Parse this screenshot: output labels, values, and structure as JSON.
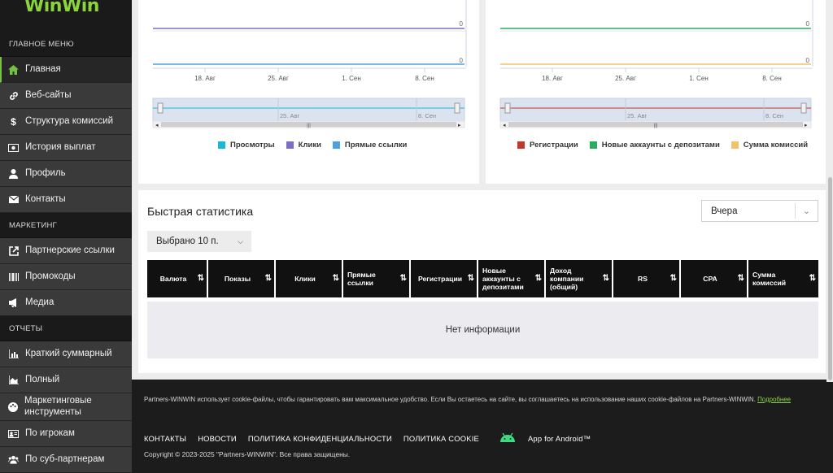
{
  "brand": {
    "logo_text": "WinWin",
    "accent": "#76c043"
  },
  "sidebar": {
    "sections": [
      {
        "title": "ГЛАВНОЕ МЕНЮ",
        "items": [
          {
            "label": "Главная",
            "icon": "home-icon",
            "active": true
          },
          {
            "label": "Веб-сайты",
            "icon": "link-icon"
          },
          {
            "label": "Структура комиссий",
            "icon": "dollar-icon"
          },
          {
            "label": "История выплат",
            "icon": "money-icon"
          },
          {
            "label": "Профиль",
            "icon": "user-icon"
          },
          {
            "label": "Контакты",
            "icon": "envelope-icon"
          }
        ]
      },
      {
        "title": "МАРКЕТИНГ",
        "items": [
          {
            "label": "Партнерские ссылки",
            "icon": "external-link-icon"
          },
          {
            "label": "Промокоды",
            "icon": "barcode-icon"
          },
          {
            "label": "Медиа",
            "icon": "megaphone-icon"
          }
        ]
      },
      {
        "title": "ОТЧЕТЫ",
        "items": [
          {
            "label": "Краткий суммарный",
            "icon": "bar-chart-icon"
          },
          {
            "label": "Полный",
            "icon": "area-chart-icon"
          },
          {
            "label": "Маркетинговые инструменты",
            "icon": "palette-icon"
          },
          {
            "label": "По игрокам",
            "icon": "id-card-icon"
          },
          {
            "label": "По суб-партнерам",
            "icon": "users-icon"
          }
        ]
      }
    ]
  },
  "chart_data": [
    {
      "type": "line",
      "x_ticks": [
        "18. Авг",
        "25. Авг",
        "1. Сен",
        "8. Сен"
      ],
      "navigator_ticks": [
        "25. Авг",
        "8. Сен"
      ],
      "series": [
        {
          "name": "Просмотры",
          "color": "#1bb8d4",
          "values": [
            0
          ]
        },
        {
          "name": "Клики",
          "color": "#7b6fc4",
          "values": [
            0
          ]
        },
        {
          "name": "Прямые ссылки",
          "color": "#4aa3df",
          "values": [
            0
          ]
        }
      ],
      "y_labels": [
        "0",
        "0"
      ]
    },
    {
      "type": "line",
      "x_ticks": [
        "18. Авг",
        "25. Авг",
        "1. Сен",
        "8. Сен"
      ],
      "navigator_ticks": [
        "25. Авг",
        "8. Сен"
      ],
      "series": [
        {
          "name": "Регистрации",
          "color": "#c0392b",
          "values": [
            0
          ]
        },
        {
          "name": "Новые аккаунты с депозитами",
          "color": "#27ae60",
          "values": [
            0
          ]
        },
        {
          "name": "Сумма комиссий",
          "color": "#f5c26b",
          "values": [
            0
          ]
        }
      ],
      "y_labels": [
        "0",
        "0"
      ]
    }
  ],
  "quick_stats": {
    "title": "Быстрая статистика",
    "period": "Вчера",
    "selected": "Выбрано 10 п.",
    "columns": [
      "Валюта",
      "Показы",
      "Клики",
      "Прямые ссылки",
      "Регистрации",
      "Новые аккаунты с депозитами",
      "Доход компании (общий)",
      "RS",
      "CPA",
      "Сумма комиссий"
    ],
    "empty_text": "Нет информации"
  },
  "footer": {
    "cookie_text": "Partners-WINWIN использует cookie-файлы, чтобы гарантировать вам максимальное удобство. Если Вы остаетесь на сайте, вы соглашаетесь на использование наших cookie-файлов на Partners-WINWIN.",
    "cookie_link": "Подробнее",
    "links": [
      "КОНТАКТЫ",
      "НОВОСТИ",
      "ПОЛИТИКА КОНФИДЕНЦИАЛЬНОСТИ",
      "ПОЛИТИКА COOKIE"
    ],
    "android_label": "App for Android™",
    "copyright": "Copyright © 2023-2025 \"Partners-WINWIN\". Все права защищены."
  }
}
